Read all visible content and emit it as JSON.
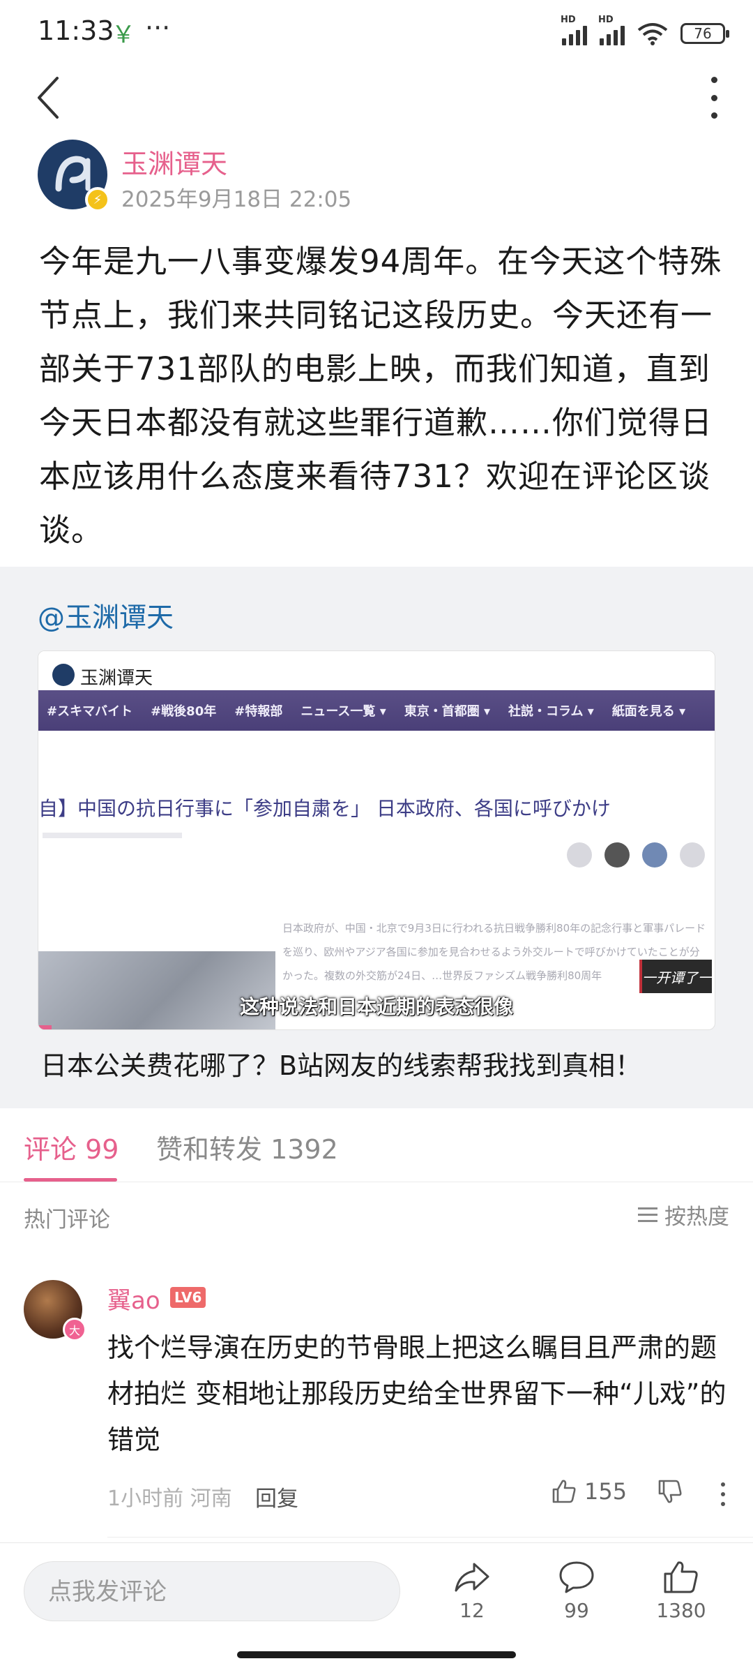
{
  "status_bar": {
    "time": "11:33",
    "extra_icon": "pay-icon",
    "dots": "···",
    "network_label_1": "HD",
    "network_label_2": "HD",
    "battery": "76"
  },
  "post": {
    "author_name": "玉渊谭天",
    "timestamp": "2025年9月18日 22:05",
    "body": "今年是九一八事变爆发94周年。在今天这个特殊节点上，我们来共同铭记这段历史。今天还有一部关于731部队的电影上映，而我们知道，直到今天日本都没有就这些罪行道歉……你们觉得日本应该用什么态度来看待731？欢迎在评论区谈谈。"
  },
  "repost": {
    "author": "@玉渊谭天",
    "video": {
      "logo_text": "玉渊谭天",
      "nav_items": [
        "#スキマバイト",
        "#戦後80年",
        "#特報部",
        "ニュース一覧 ▾",
        "東京・首都圏 ▾",
        "社説・コラム ▾",
        "紙面を見る ▾"
      ],
      "headline": "自】中国の抗日行事に「参加自粛を」 日本政府、各国に呼びかけ",
      "body_text": "日本政府が、中国・北京で9月3日に行われる抗日戦争勝利80年の記念行事と軍事パレードを巡り、欧州やアジア各国に参加を見合わせるよう外交ルートで呼びかけていたことが分かった。複数の外交筋が24日、…世界反ファシズム戦争勝利80周年",
      "stamp": "一开谭了一",
      "subtitle": "这种说法和日本近期的表态很像",
      "progress_fraction": 0.02
    },
    "title": "日本公关费花哪了？B站网友的线索帮我找到真相！"
  },
  "tabs": {
    "comments": "评论 99",
    "likes_reposts": "赞和转发 1392"
  },
  "comments_header": {
    "hot_label": "热门评论",
    "sort_label": "按热度"
  },
  "comments": [
    {
      "name": "翼ao",
      "level": "LV6",
      "avatar_badge": "大",
      "text": "找个烂导演在历史的节骨眼上把这么瞩目且严肃的题材拍烂  变相地让那段历史给全世界留下一种“儿戏”的错觉",
      "time_location": "1小时前  河南",
      "reply_label": "回复",
      "likes": "155"
    }
  ],
  "bottom_bar": {
    "input_placeholder": "点我发评论",
    "share_count": "12",
    "comment_count": "99",
    "like_count": "1380"
  },
  "colors": {
    "accent": "#e6608c",
    "link": "#1e6aa8",
    "repost_bg": "#f1f2f4"
  }
}
